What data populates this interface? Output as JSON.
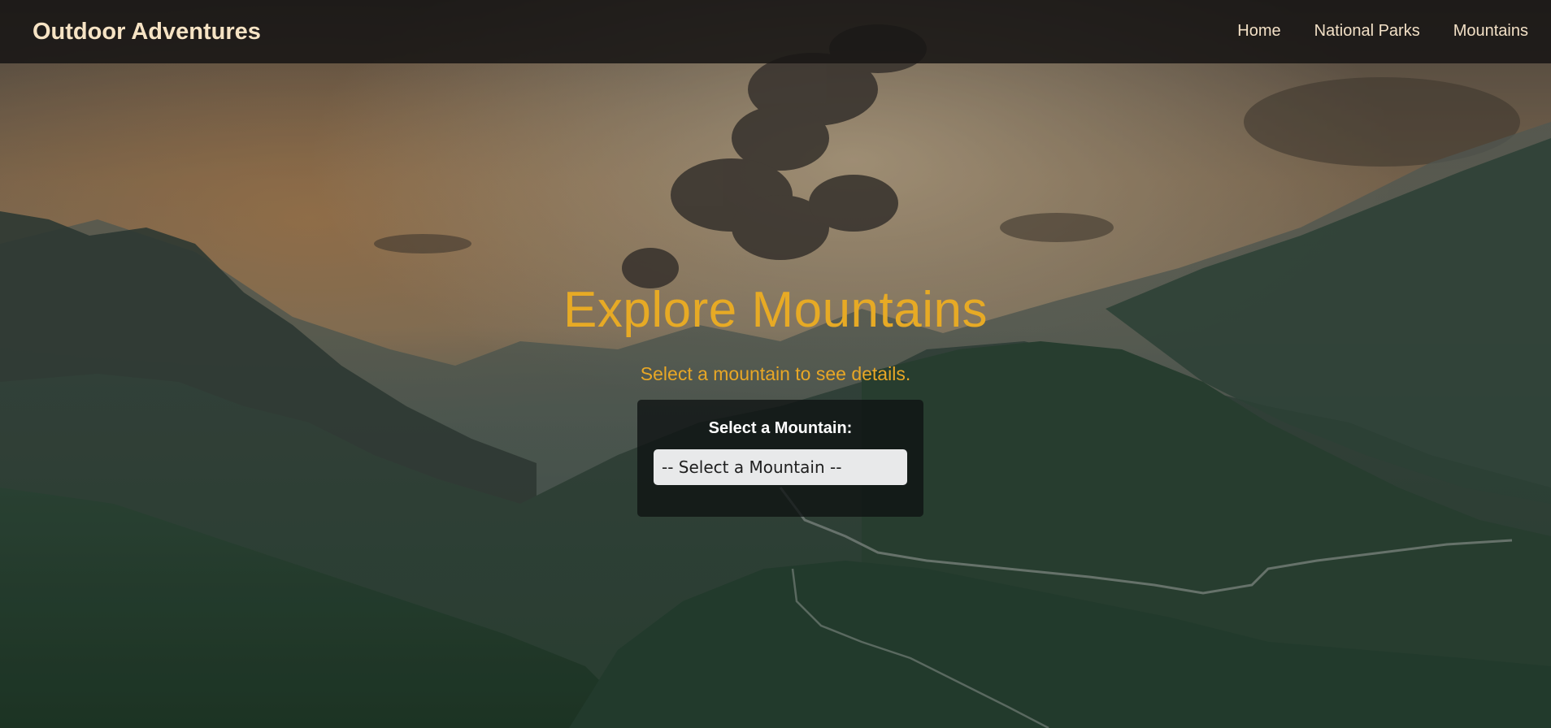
{
  "navbar": {
    "brand": "Outdoor Adventures",
    "links": [
      {
        "label": "Home"
      },
      {
        "label": "National Parks"
      },
      {
        "label": "Mountains"
      }
    ]
  },
  "hero": {
    "title": "Explore Mountains",
    "subtitle": "Select a mountain to see details.",
    "select": {
      "label": "Select a Mountain:",
      "selected": "-- Select a Mountain --"
    },
    "background": "mountain-landscape-image"
  },
  "colors": {
    "accent": "#e7aa25",
    "navbar_bg": "#181614",
    "brand_text": "#f6e3c4"
  }
}
